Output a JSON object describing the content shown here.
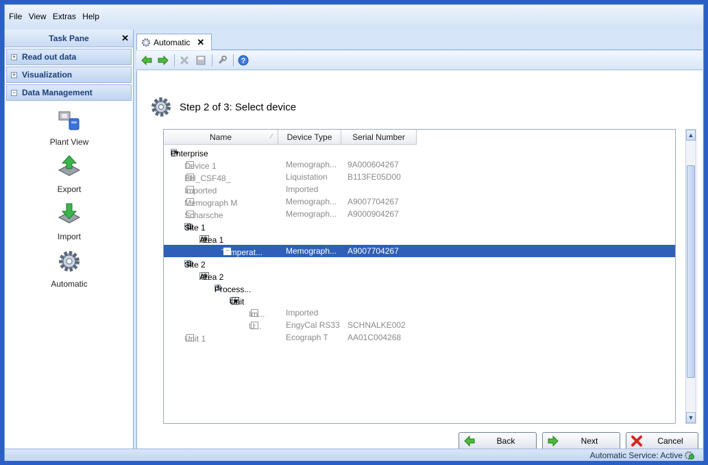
{
  "menu": {
    "file": "File",
    "view": "View",
    "extras": "Extras",
    "help": "Help"
  },
  "taskpane": {
    "title": "Task Pane",
    "groups": [
      {
        "label": "Read out data",
        "toggle": "+"
      },
      {
        "label": "Visualization",
        "toggle": "+"
      },
      {
        "label": "Data Management",
        "toggle": "−"
      }
    ],
    "items": [
      {
        "label": "Plant View",
        "icon": "plant-view-icon"
      },
      {
        "label": "Export",
        "icon": "export-icon"
      },
      {
        "label": "Import",
        "icon": "import-icon"
      },
      {
        "label": "Automatic",
        "icon": "automatic-gear-icon"
      }
    ]
  },
  "tab": {
    "label": "Automatic"
  },
  "toolbar": {
    "buttons": [
      "back-arrow-icon",
      "forward-arrow-icon",
      "delete-icon",
      "save-icon",
      "wrench-icon",
      "help-icon"
    ]
  },
  "step": {
    "title": "Step 2 of 3: Select device"
  },
  "grid": {
    "columns": [
      "Name",
      "Device Type",
      "Serial Number"
    ],
    "rows": [
      {
        "name": "Enterprise",
        "type": "",
        "serial": ""
      },
      {
        "name": "Device 1",
        "type": "Memograph...",
        "serial": "9A000604267"
      },
      {
        "name": "EH_CSF48_",
        "type": "Liquistation",
        "serial": "B113FE05D00"
      },
      {
        "name": "Imported",
        "type": "Imported",
        "serial": ""
      },
      {
        "name": "Memograph M",
        "type": "Memograph...",
        "serial": "A9007704267"
      },
      {
        "name": "Scharsche",
        "type": "Memograph...",
        "serial": "A9000904267"
      },
      {
        "name": "Site 1",
        "type": "",
        "serial": ""
      },
      {
        "name": "Area 1",
        "type": "",
        "serial": ""
      },
      {
        "name": "Temperat...",
        "type": "Memograph...",
        "serial": "A9007704267"
      },
      {
        "name": "Site 2",
        "type": "",
        "serial": ""
      },
      {
        "name": "Area 2",
        "type": "",
        "serial": ""
      },
      {
        "name": "Process...",
        "type": "",
        "serial": ""
      },
      {
        "name": "Unit",
        "type": "",
        "serial": ""
      },
      {
        "name": "Im...",
        "type": "Imported",
        "serial": ""
      },
      {
        "name": "U...",
        "type": "EngyCal RS33",
        "serial": "SCHNALKE002"
      },
      {
        "name": "Unit 1",
        "type": "Ecograph T",
        "serial": "AA01C004268"
      }
    ]
  },
  "buttons": {
    "back": "Back",
    "next": "Next",
    "cancel": "Cancel"
  },
  "status": {
    "text": "Automatic Service: Active"
  },
  "colors": {
    "selection": "#2f5fb8",
    "accent": "#2a5fc4"
  }
}
